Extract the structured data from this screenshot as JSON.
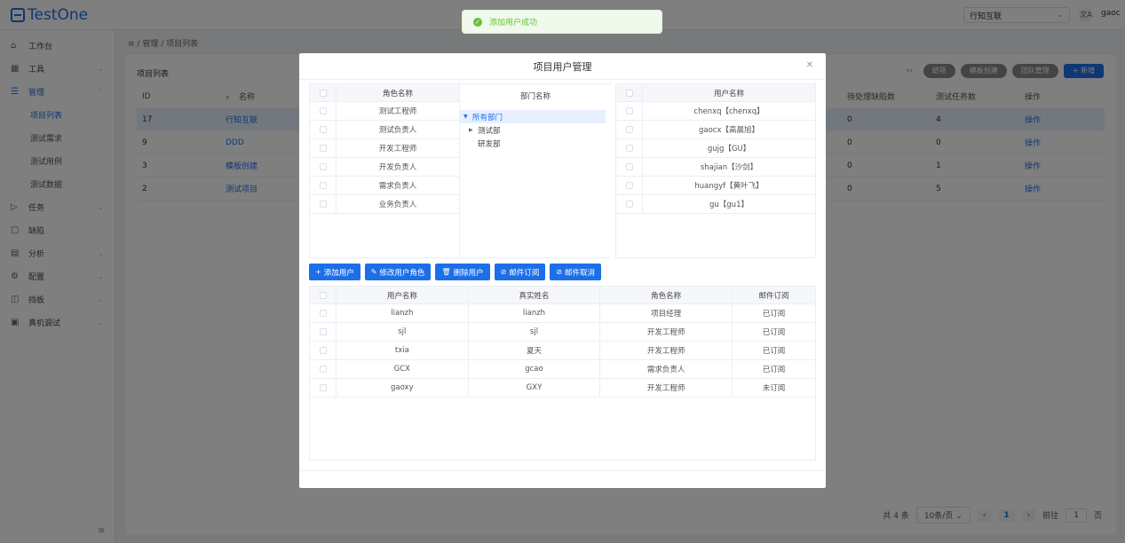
{
  "app": {
    "logo": "TestOne",
    "project_select": "行知互联",
    "lang_icon": "文A",
    "user": "gaoc"
  },
  "sidebar": {
    "items": [
      {
        "label": "工作台",
        "icon": "home-icon",
        "glyph": "⌂"
      },
      {
        "label": "工具",
        "icon": "grid-icon",
        "glyph": "▦"
      },
      {
        "label": "管理",
        "icon": "list-icon",
        "glyph": "☰"
      },
      {
        "label": "任务",
        "icon": "send-icon",
        "glyph": "▷"
      },
      {
        "label": "缺陷",
        "icon": "doc-icon",
        "glyph": "▢"
      },
      {
        "label": "分析",
        "icon": "calendar-icon",
        "glyph": "▤"
      },
      {
        "label": "配置",
        "icon": "gear-icon",
        "glyph": "⚙"
      },
      {
        "label": "挡板",
        "icon": "panel-icon",
        "glyph": "◫"
      },
      {
        "label": "真机调试",
        "icon": "device-icon",
        "glyph": "▣"
      }
    ],
    "sub_items": [
      "项目列表",
      "测试需求",
      "测试用例",
      "测试数据"
    ]
  },
  "breadcrumb": {
    "home": "≡",
    "sep": "/",
    "parent": "管理",
    "current": "项目列表"
  },
  "list": {
    "title": "项目列表",
    "buttons": {
      "end": "结项",
      "template": "模板创建",
      "team": "团队管理",
      "add": "+ 新增"
    },
    "headers": {
      "id": "ID",
      "name": "名称",
      "pending": "待处理缺陷数",
      "tasks": "测试任务数",
      "ops": "操作"
    },
    "rows": [
      {
        "id": "17",
        "name": "行知互联",
        "pending": "0",
        "tasks": "4",
        "op": "操作"
      },
      {
        "id": "9",
        "name": "DDD",
        "pending": "0",
        "tasks": "0",
        "op": "操作"
      },
      {
        "id": "3",
        "name": "模板创建",
        "pending": "0",
        "tasks": "1",
        "op": "操作"
      },
      {
        "id": "2",
        "name": "测试项目",
        "pending": "0",
        "tasks": "5",
        "op": "操作"
      }
    ],
    "pager": {
      "total": "共 4 条",
      "size": "10条/页",
      "page": "1",
      "goto": "前往",
      "goto_val": "1",
      "unit": "页"
    }
  },
  "toast": {
    "text": "添加用户成功"
  },
  "modal": {
    "title": "项目用户管理",
    "roles": {
      "header": "角色名称",
      "items": [
        "测试工程师",
        "测试负责人",
        "开发工程师",
        "开发负责人",
        "需求负责人",
        "业务负责人"
      ]
    },
    "dept": {
      "header": "部门名称",
      "root": "所有部门",
      "children": [
        "测试部",
        "研发部"
      ]
    },
    "users": {
      "header": "用户名称",
      "items": [
        "chenxq【chenxq】",
        "gaocx【高晨旭】",
        "gujg【GU】",
        "shajian【沙剑】",
        "huangyf【黄叶飞】",
        "gu【gu1】"
      ]
    },
    "actions": [
      {
        "label": "添加用户",
        "icon": "+"
      },
      {
        "label": "修改用户角色",
        "icon": "✎"
      },
      {
        "label": "删除用户",
        "icon": "🗑"
      },
      {
        "label": "邮件订阅",
        "icon": "⊘"
      },
      {
        "label": "邮件取消",
        "icon": "⊘"
      }
    ],
    "members": {
      "headers": [
        "用户名称",
        "真实姓名",
        "角色名称",
        "邮件订阅"
      ],
      "rows": [
        [
          "lianzh",
          "lianzh",
          "项目经理",
          "已订阅"
        ],
        [
          "sjl",
          "sjl",
          "开发工程师",
          "已订阅"
        ],
        [
          "txia",
          "夏天",
          "开发工程师",
          "已订阅"
        ],
        [
          "GCX",
          "gcao",
          "需求负责人",
          "已订阅"
        ],
        [
          "gaoxy",
          "GXY",
          "开发工程师",
          "未订阅"
        ]
      ]
    }
  }
}
